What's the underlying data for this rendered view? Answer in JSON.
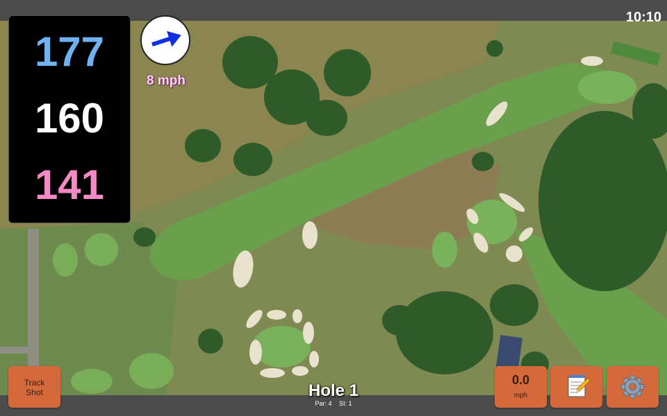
{
  "status": {
    "time": "10:10"
  },
  "yardages": {
    "back": "177",
    "middle": "160",
    "front": "141"
  },
  "wind": {
    "speed_label": "8 mph",
    "direction_icon": "wind-arrow-icon"
  },
  "hole": {
    "title": "Hole 1",
    "par": "Par: 4",
    "si": "SI: 1"
  },
  "buttons": {
    "track_line1": "Track",
    "track_line2": "Shot",
    "speed_value": "0.0",
    "speed_unit": "mph",
    "notes_icon": "notepad-icon",
    "settings_icon": "gear-icon"
  },
  "colors": {
    "back": "#6fb2f2",
    "middle": "#ffffff",
    "front": "#f48ac4",
    "button": "#d46a3c"
  }
}
